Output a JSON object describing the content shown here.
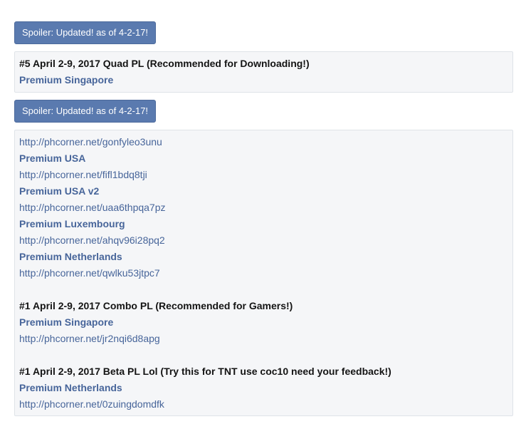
{
  "spoiler1": {
    "label": "Spoiler: Updated! as of 4-2-17!"
  },
  "box1": {
    "heading": "#5 April 2-9, 2017 Quad PL (Recommended for Downloading!)",
    "server": "Premium Singapore"
  },
  "spoiler2": {
    "label": "Spoiler: Updated! as of 4-2-17!"
  },
  "box2": {
    "link0": "http://phcorner.net/gonfyleo3unu",
    "server1": "Premium USA",
    "link1": "http://phcorner.net/fifl1bdq8tji",
    "server2": "Premium USA v2",
    "link2": "http://phcorner.net/uaa6thpqa7pz",
    "server3": "Premium Luxembourg",
    "link3": "http://phcorner.net/ahqv96i28pq2",
    "server4": "Premium Netherlands",
    "link4": "http://phcorner.net/qwlku53jtpc7",
    "heading2": "#1 April 2-9, 2017 Combo PL (Recommended for Gamers!)",
    "server5": "Premium Singapore",
    "link5": "http://phcorner.net/jr2nqi6d8apg",
    "heading3": "#1 April 2-9, 2017 Beta PL Lol (Try this for TNT use coc10 need your feedback!)",
    "server6": "Premium Netherlands",
    "link6": "http://phcorner.net/0zuingdomdfk"
  }
}
